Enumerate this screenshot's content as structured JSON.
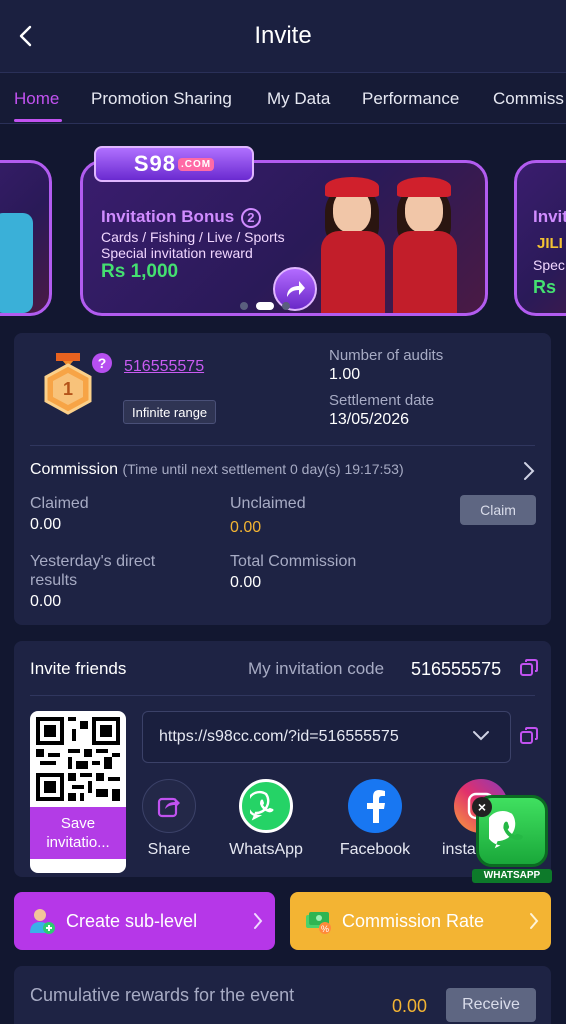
{
  "header": {
    "title": "Invite"
  },
  "tabs": [
    {
      "label": "Home",
      "active": true
    },
    {
      "label": "Promotion Sharing",
      "active": false
    },
    {
      "label": "My Data",
      "active": false
    },
    {
      "label": "Performance",
      "active": false
    },
    {
      "label": "Commiss",
      "active": false
    }
  ],
  "banner": {
    "logo": "S98",
    "logo_suffix": ".COM",
    "title": "Invitation Bonus",
    "title_badge": "2",
    "line1": "Cards / Fishing / Live / Sports",
    "line2": "Special invitation reward",
    "amount": "Rs 1,000",
    "right_peek": {
      "line1": "Invit",
      "line2": "JILI",
      "line3": "Spec",
      "line4": "Rs"
    }
  },
  "agent": {
    "level_number": "1",
    "user_id": "516555575",
    "range_tag": "Infinite range",
    "audits_label": "Number of audits",
    "audits_value": "1.00",
    "settlement_label": "Settlement date",
    "settlement_value": "13/05/2026"
  },
  "commission": {
    "title": "Commission",
    "countdown": "(Time until next settlement 0 day(s) 19:17:53)",
    "claimed_label": "Claimed",
    "claimed_value": "0.00",
    "unclaimed_label": "Unclaimed",
    "unclaimed_value": "0.00",
    "claim_button": "Claim",
    "yesterday_label_1": "Yesterday's direct",
    "yesterday_label_2": "results",
    "yesterday_value": "0.00",
    "total_label": "Total Commission",
    "total_value": "0.00"
  },
  "invite": {
    "title": "Invite friends",
    "code_label": "My invitation code",
    "code_value": "516555575",
    "link": "https://s98cc.com/?id=516555575",
    "save_label_1": "Save",
    "save_label_2": "invitatio...",
    "share": [
      {
        "label": "Share",
        "icon": "share-icon"
      },
      {
        "label": "WhatsApp",
        "icon": "whatsapp-icon"
      },
      {
        "label": "Facebook",
        "icon": "facebook-icon"
      },
      {
        "label": "insta",
        "icon": "instagram-icon"
      }
    ]
  },
  "floating": {
    "label": "WHATSAPP"
  },
  "actions": {
    "create_sublevel": "Create sub-level",
    "commission_rate": "Commission Rate"
  },
  "rewards": {
    "label": "Cumulative rewards for the event",
    "value": "0.00",
    "receive_button": "Receive"
  },
  "colors": {
    "background": "#121730",
    "card": "#1e2344",
    "accent_purple": "#c152f0",
    "accent_orange": "#f3b433",
    "bonus_green": "#44e070"
  }
}
